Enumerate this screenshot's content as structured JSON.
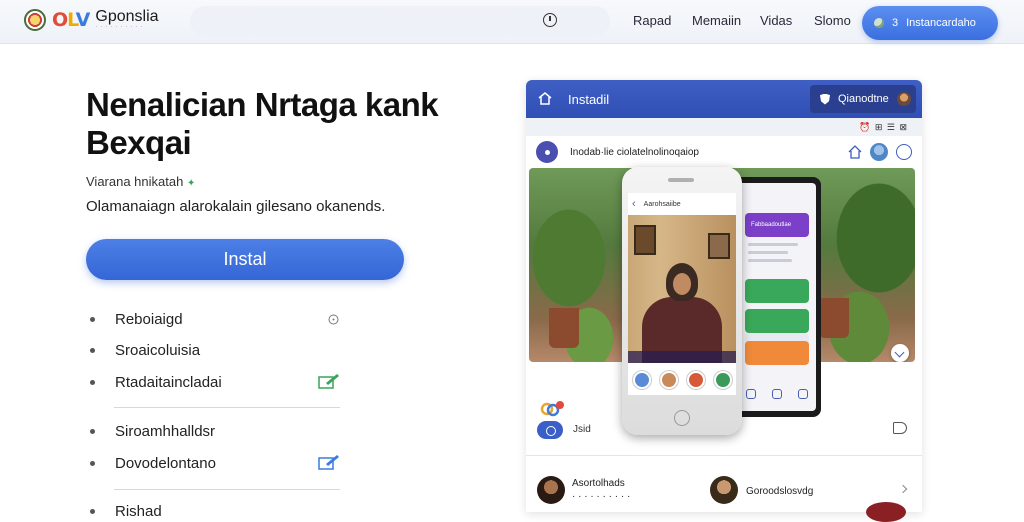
{
  "topbar": {
    "logo_letters": [
      "O",
      "L",
      "V"
    ],
    "logo_name": "Gponslia",
    "logo_tag": "· · · · · · · · · ·",
    "nav": [
      "Rapad",
      "Memaiin",
      "Vidas",
      "Slomo"
    ],
    "cta_number": "3",
    "cta_label": "Instancardaho",
    "icons": [
      "clock-icon"
    ]
  },
  "hero": {
    "headline_line1": "Nenalician Nrtaga kank",
    "headline_line2": "Bexqai",
    "sub1": "Viarana hnikatah",
    "sub2": "Olamanaiagn alarokalain gilesano okanends.",
    "install_label": "Instal"
  },
  "features": [
    {
      "label": "Reboiaigd",
      "icon": "info-icon"
    },
    {
      "label": "Sroaicoluisia",
      "icon": ""
    },
    {
      "label": "Rtadaitaincladai",
      "icon": "edit-icon"
    },
    {
      "label": "Siroamhhalldsr",
      "icon": ""
    },
    {
      "label": "Dovodelontano",
      "icon": "edit-icon"
    },
    {
      "label": "Rishad",
      "icon": ""
    }
  ],
  "card": {
    "title": "Instadil",
    "chip_label": "Qianodtne",
    "toolbar_text": "⏰ ⊞ ☰ ⊠",
    "post_name": "Inodab·lie ciolatelnolinoqaiop",
    "reaction_count": "Jsid",
    "comments": [
      {
        "text": "Asortolhads\n· · · · · · · · · ·"
      },
      {
        "text": "Goroodslosvdg"
      }
    ],
    "phone_front": {
      "top_text": "Aarohsaiibe",
      "back_glyph": "‹"
    },
    "phone_back": {
      "bar1_label": "Fabbaadoutlae",
      "bars": [
        "#7b3fc8",
        "#3aa85a",
        "#3aa85a",
        "#f08a3a"
      ]
    }
  },
  "colors": {
    "primary": "#3b6fe0",
    "card_header": "#2f4fb5",
    "text": "#1a1a1a"
  }
}
